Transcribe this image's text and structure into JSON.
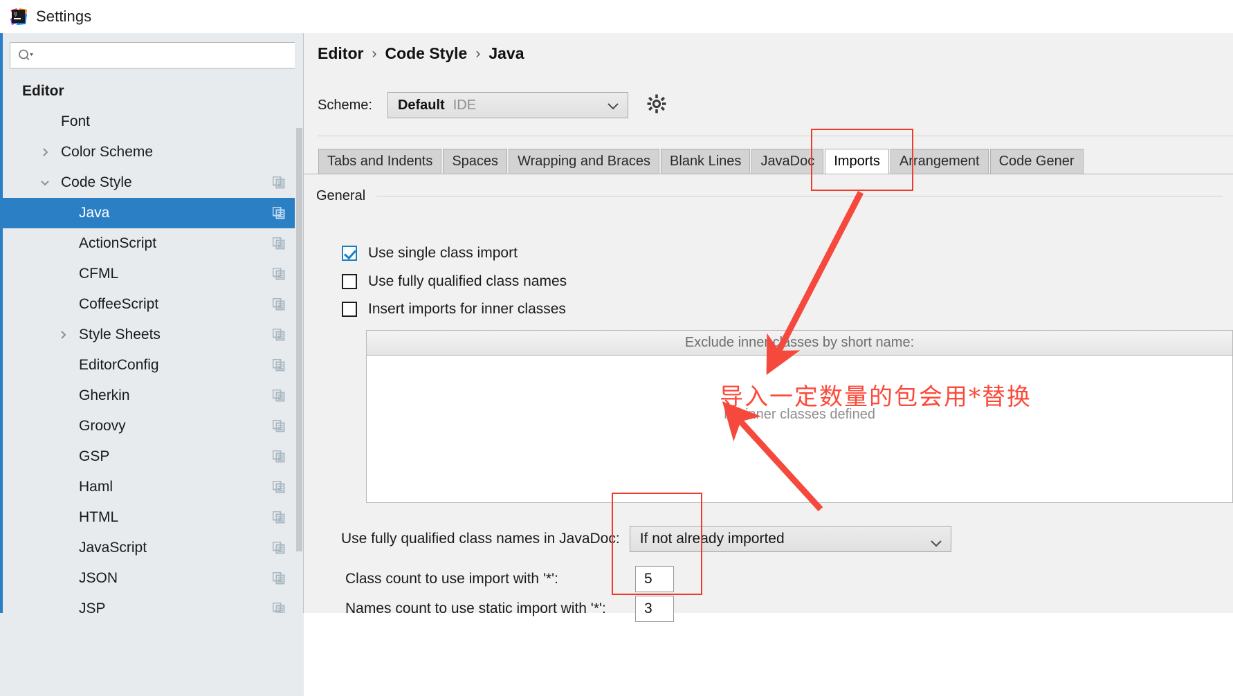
{
  "window": {
    "title": "Settings",
    "logo_icon": "intellij-idea-logo"
  },
  "sidebar": {
    "search": {
      "value": "",
      "placeholder": "",
      "icon": "search-icon"
    },
    "items": [
      {
        "label": "Editor",
        "indent": 28,
        "bold": true,
        "twisty": "",
        "selected": false,
        "copy": false
      },
      {
        "label": "Font",
        "indent": 84,
        "bold": false,
        "twisty": "",
        "selected": false,
        "copy": false
      },
      {
        "label": "Color Scheme",
        "indent": 84,
        "bold": false,
        "twisty": "right",
        "selected": false,
        "copy": false
      },
      {
        "label": "Code Style",
        "indent": 84,
        "bold": false,
        "twisty": "down",
        "selected": false,
        "copy": true
      },
      {
        "label": "Java",
        "indent": 110,
        "bold": false,
        "twisty": "",
        "selected": true,
        "copy": true
      },
      {
        "label": "ActionScript",
        "indent": 110,
        "bold": false,
        "twisty": "",
        "selected": false,
        "copy": true
      },
      {
        "label": "CFML",
        "indent": 110,
        "bold": false,
        "twisty": "",
        "selected": false,
        "copy": true
      },
      {
        "label": "CoffeeScript",
        "indent": 110,
        "bold": false,
        "twisty": "",
        "selected": false,
        "copy": true
      },
      {
        "label": "Style Sheets",
        "indent": 110,
        "bold": false,
        "twisty": "right",
        "selected": false,
        "copy": true
      },
      {
        "label": "EditorConfig",
        "indent": 110,
        "bold": false,
        "twisty": "",
        "selected": false,
        "copy": true
      },
      {
        "label": "Gherkin",
        "indent": 110,
        "bold": false,
        "twisty": "",
        "selected": false,
        "copy": true
      },
      {
        "label": "Groovy",
        "indent": 110,
        "bold": false,
        "twisty": "",
        "selected": false,
        "copy": true
      },
      {
        "label": "GSP",
        "indent": 110,
        "bold": false,
        "twisty": "",
        "selected": false,
        "copy": true
      },
      {
        "label": "Haml",
        "indent": 110,
        "bold": false,
        "twisty": "",
        "selected": false,
        "copy": true
      },
      {
        "label": "HTML",
        "indent": 110,
        "bold": false,
        "twisty": "",
        "selected": false,
        "copy": true
      },
      {
        "label": "JavaScript",
        "indent": 110,
        "bold": false,
        "twisty": "",
        "selected": false,
        "copy": true
      },
      {
        "label": "JSON",
        "indent": 110,
        "bold": false,
        "twisty": "",
        "selected": false,
        "copy": true
      },
      {
        "label": "JSP",
        "indent": 110,
        "bold": false,
        "twisty": "",
        "selected": false,
        "copy": true
      }
    ]
  },
  "main": {
    "breadcrumb": [
      "Editor",
      "Code Style",
      "Java"
    ],
    "breadcrumb_separator": "›",
    "scheme": {
      "label": "Scheme:",
      "name": "Default",
      "sub": "IDE",
      "chevron_icon": "chevron-down-icon",
      "gear_icon": "gear-icon"
    },
    "tabs": [
      {
        "label": "Tabs and Indents",
        "active": false
      },
      {
        "label": "Spaces",
        "active": false
      },
      {
        "label": "Wrapping and Braces",
        "active": false
      },
      {
        "label": "Blank Lines",
        "active": false
      },
      {
        "label": "JavaDoc",
        "active": false
      },
      {
        "label": "Imports",
        "active": true
      },
      {
        "label": "Arrangement",
        "active": false
      },
      {
        "label": "Code Gener",
        "active": false
      }
    ],
    "general_label": "General",
    "checkboxes": [
      {
        "label": "Use single class import",
        "checked": true
      },
      {
        "label": "Use fully qualified class names",
        "checked": false
      },
      {
        "label": "Insert imports for inner classes",
        "checked": false
      }
    ],
    "exclude_table": {
      "header": "Exclude inner classes by short name:",
      "empty_text": "No inner classes defined"
    },
    "fqcn_javadoc": {
      "label": "Use fully qualified class names in JavaDoc:",
      "value": "If not already imported",
      "chevron_icon": "chevron-down-icon"
    },
    "class_count": {
      "label": "Class count to use import with '*':",
      "value": "5"
    },
    "names_count": {
      "label": "Names count to use static import with '*':",
      "value": "3"
    }
  },
  "annotations": {
    "color": "#ef3b2c",
    "text": "导入一定数量的包会用*替换"
  },
  "colors": {
    "accent": "#2b7fc4",
    "sidebar_bg": "#e7ebee",
    "panel_bg": "#f1f1f1",
    "selection": "#2b7fc4",
    "annotation_red": "#ef3b2c"
  }
}
